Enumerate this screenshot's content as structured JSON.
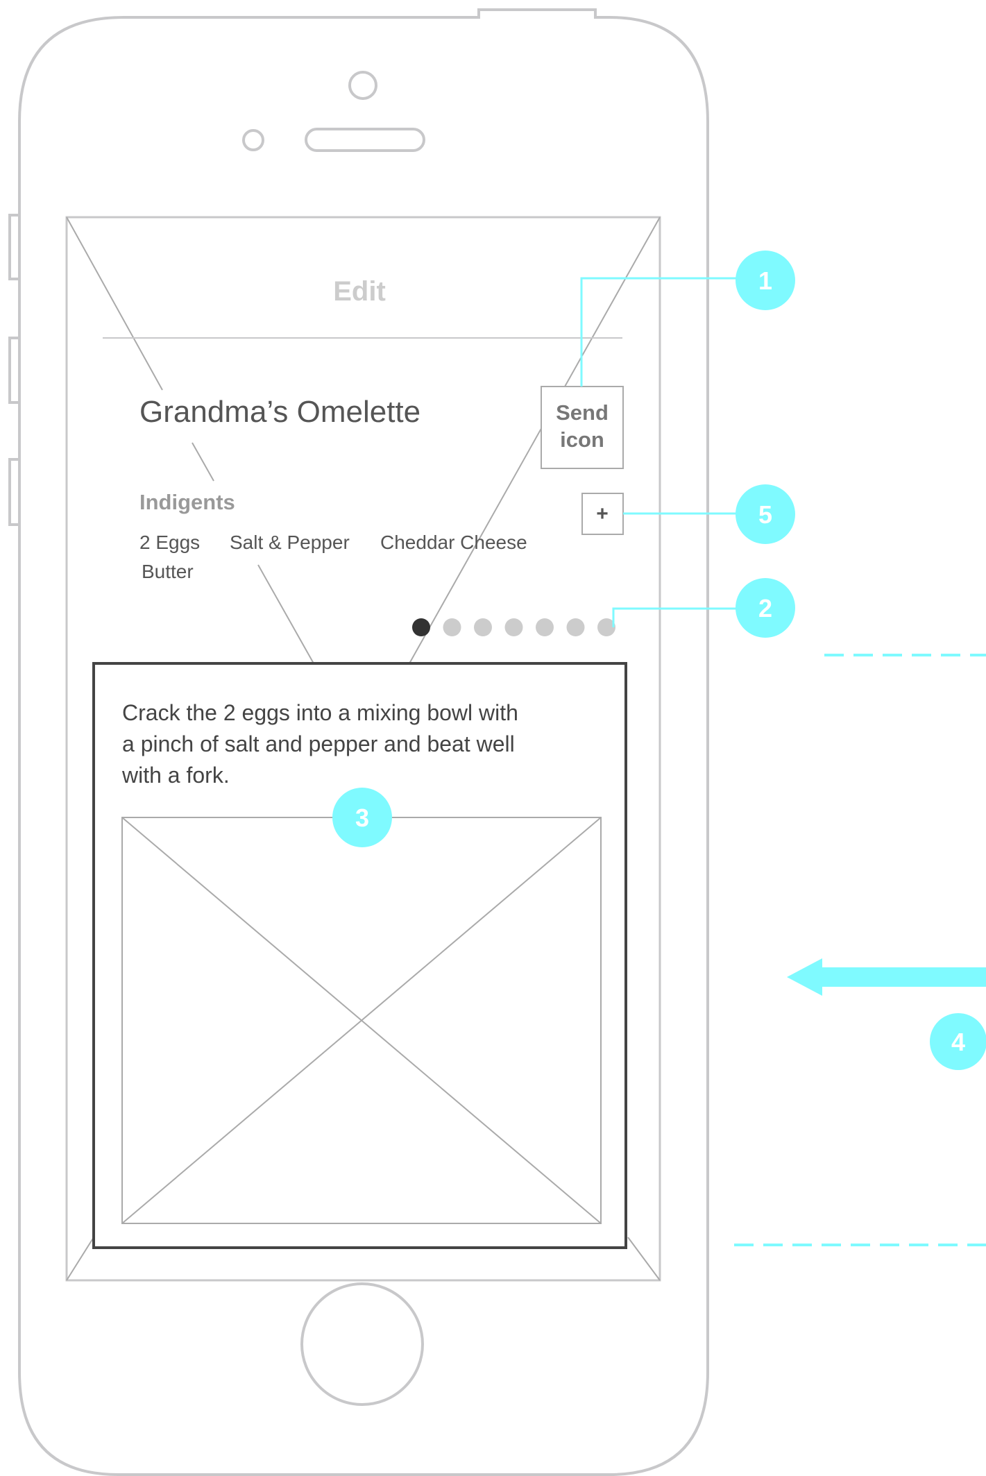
{
  "screen": {
    "header_title": "Edit",
    "recipe_title": "Grandma’s Omelette",
    "send_button": {
      "line1": "Send",
      "line2": "icon"
    },
    "add_button": "+",
    "ingredients_heading": "Indigents",
    "ingredients": [
      "2 Eggs",
      "Salt & Pepper",
      "Cheddar Cheese",
      "Butter"
    ],
    "page_indicator": {
      "total": 7,
      "active": 1
    },
    "step_card": {
      "lines": [
        "Crack the 2 eggs into a mixing bowl with",
        "a pinch of salt and pepper and beat well",
        "with a fork."
      ]
    }
  },
  "annotations": {
    "markers": [
      "1",
      "2",
      "3",
      "4",
      "5"
    ]
  },
  "colors": {
    "device_outline": "#c8c8ca",
    "wire_line": "#aaaaaa",
    "annotation": "#7ffaff",
    "card_border": "#444444",
    "dot_active": "#333333",
    "dot_inactive": "#cccccc",
    "title_text": "#555555",
    "muted_text": "#999999",
    "header_text": "#cccccc",
    "body_text": "#444444"
  }
}
